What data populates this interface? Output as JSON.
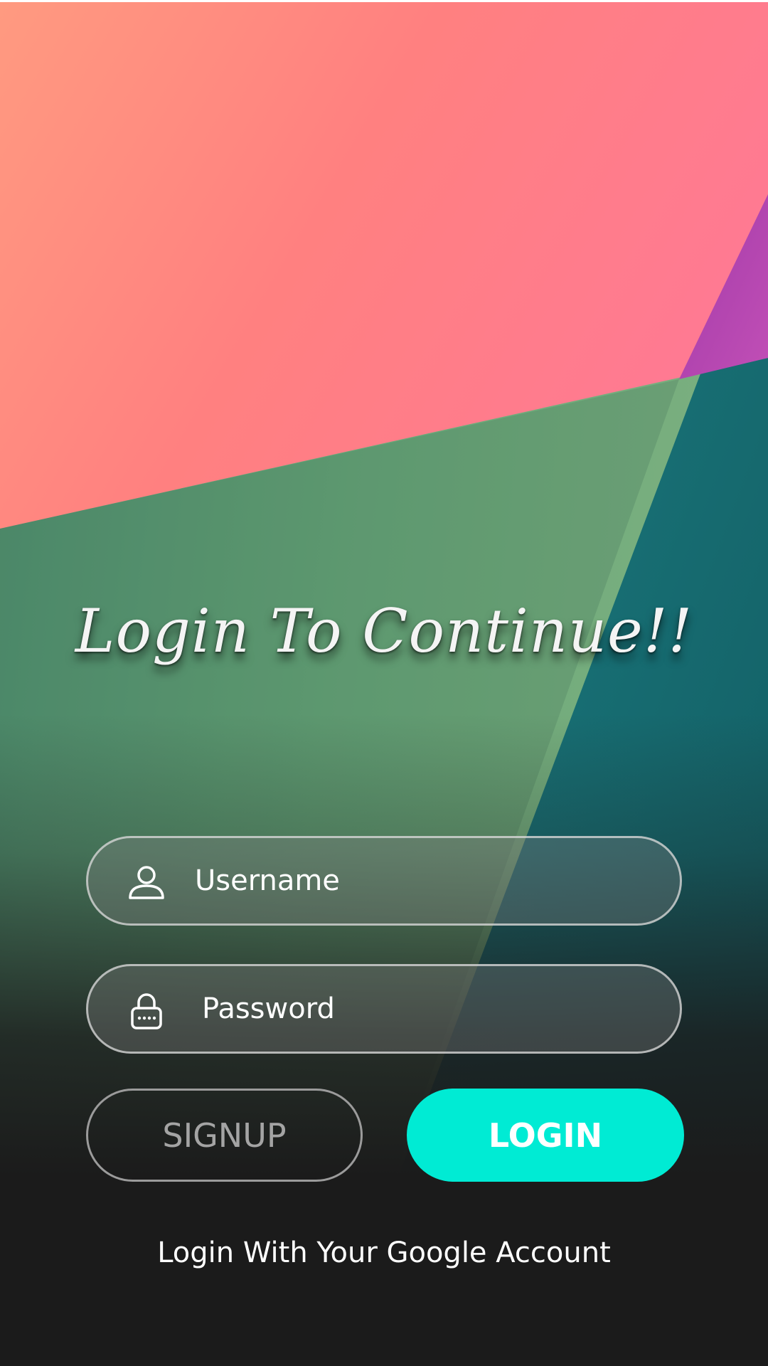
{
  "title": "Login To Continue!!",
  "username_field": {
    "icon": "user-icon",
    "placeholder": "Username",
    "value": ""
  },
  "password_field": {
    "icon": "lock-icon",
    "placeholder": "Password",
    "value": ""
  },
  "buttons": {
    "signup_label": "SIGNUP",
    "login_label": "LOGIN"
  },
  "google_link": "Login With Your Google Account",
  "colors": {
    "accent": "#00ebd4",
    "background_dark": "#1b1b1b",
    "bg_pink": "#ff7e88",
    "bg_green": "#6faa7c",
    "bg_teal": "#166e72",
    "bg_purple": "#b03fb0"
  }
}
